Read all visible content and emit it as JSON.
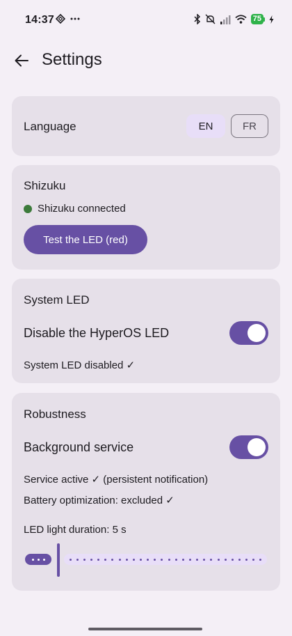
{
  "status_bar": {
    "time": "14:37",
    "left_icons": [
      "sync-icon",
      "more-dots-icon"
    ],
    "right_icons": [
      "bluetooth-icon",
      "do-not-disturb-icon",
      "signal-icon",
      "wifi-icon"
    ],
    "battery": "75"
  },
  "app_bar": {
    "title": "Settings"
  },
  "language": {
    "label": "Language",
    "options": [
      "EN",
      "FR"
    ],
    "selected": "EN"
  },
  "shizuku": {
    "title": "Shizuku",
    "status": "Shizuku connected",
    "status_color": "#3c7a3b",
    "test_button": "Test the LED (red)"
  },
  "system_led": {
    "title": "System LED",
    "toggle_label": "Disable the HyperOS LED",
    "toggle_on": true,
    "status": "System LED disabled ✓"
  },
  "robustness": {
    "title": "Robustness",
    "toggle_label": "Background service",
    "toggle_on": true,
    "service_status": "Service active ✓ (persistent notification)",
    "battery_status": "Battery optimization: excluded ✓",
    "duration_label": "LED light duration: 5 s",
    "slider_fraction": 0.13
  },
  "colors": {
    "accent": "#6750a4",
    "card": "#e6e0e9",
    "background": "#f4eff6",
    "selected_chip": "#e8def8"
  }
}
